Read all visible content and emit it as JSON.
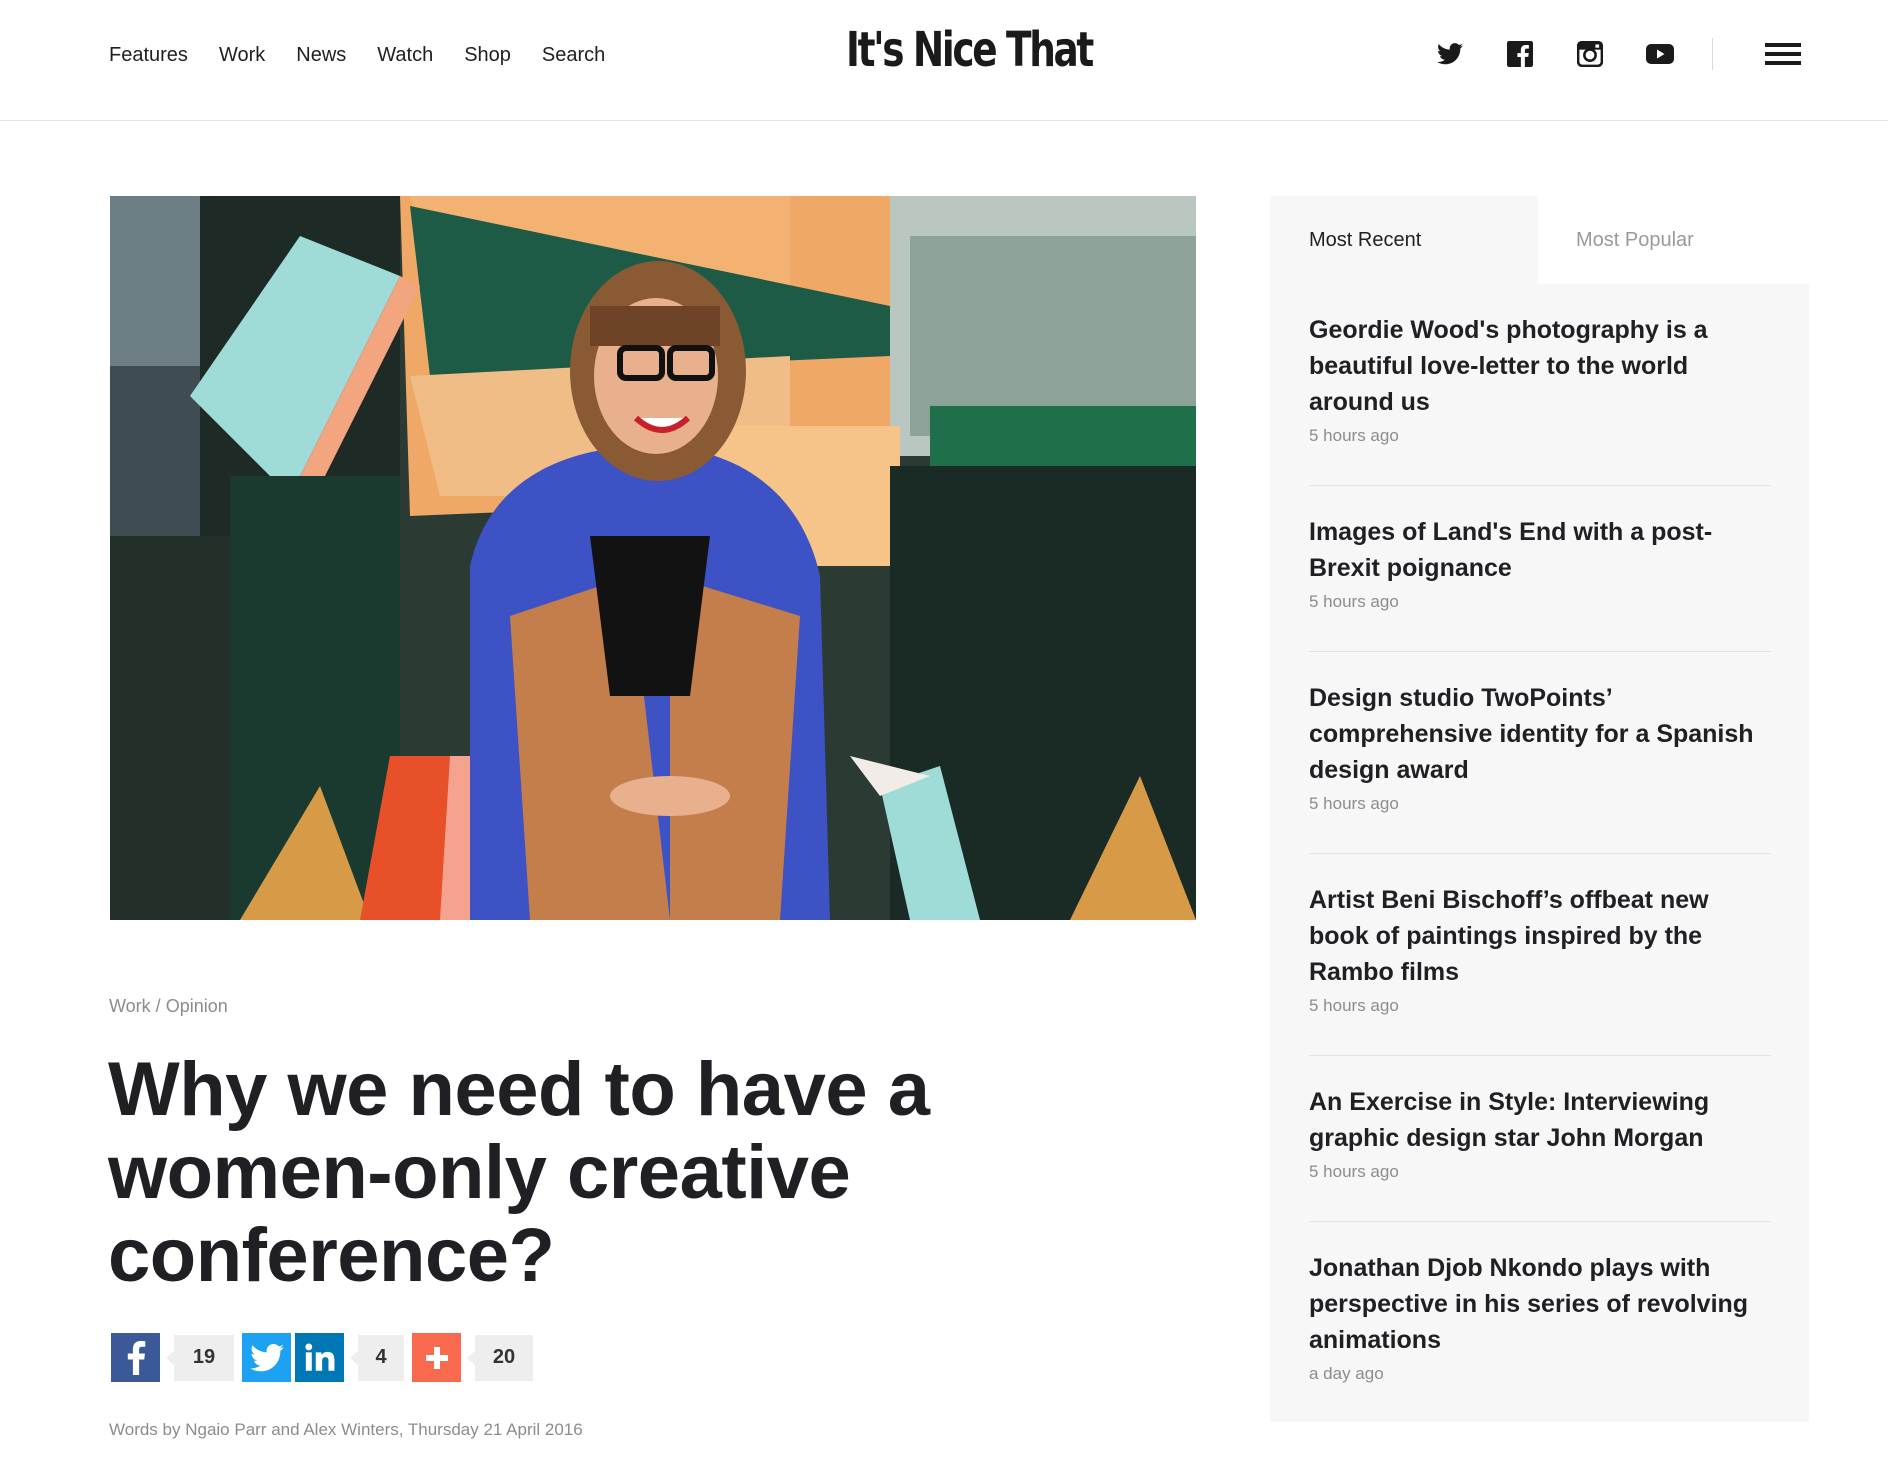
{
  "nav": {
    "items": [
      "Features",
      "Work",
      "News",
      "Watch",
      "Shop",
      "Search"
    ]
  },
  "logo": "It's Nice That",
  "social": [
    "twitter-icon",
    "facebook-icon",
    "instagram-icon",
    "youtube-icon"
  ],
  "article": {
    "breadcrumb_section": "Work",
    "breadcrumb_sep": " / ",
    "breadcrumb_category": "Opinion",
    "title": "Why we need to have a women-only creative conference?",
    "share": {
      "facebook_count": "19",
      "linkedin_count": "4",
      "plus_count": "20"
    },
    "byline": "Words by Ngaio Parr and Alex Winters, Thursday 21 April 2016"
  },
  "sidebar": {
    "tabs": [
      "Most Recent",
      "Most Popular"
    ],
    "items": [
      {
        "title": "Geordie Wood's photography is a beautiful love-letter to the world around us",
        "ago": "5 hours ago"
      },
      {
        "title": "Images of Land's End with a post-Brexit poignance",
        "ago": "5 hours ago"
      },
      {
        "title": "Design studio TwoPoints’ comprehensive identity for a Spanish design award",
        "ago": "5 hours ago"
      },
      {
        "title": "Artist Beni Bischoff’s offbeat new book of paintings inspired by the Rambo films",
        "ago": "5 hours ago"
      },
      {
        "title": "An Exercise in Style: Interviewing graphic design star John Morgan",
        "ago": "5 hours ago"
      },
      {
        "title": "Jonathan Djob Nkondo plays with perspective in his series of revolving animations",
        "ago": "a day ago"
      }
    ]
  },
  "colors": {
    "facebook": "#3b5998",
    "twitter": "#1da1f2",
    "linkedin": "#0077b5",
    "addthis": "#f8694d"
  }
}
